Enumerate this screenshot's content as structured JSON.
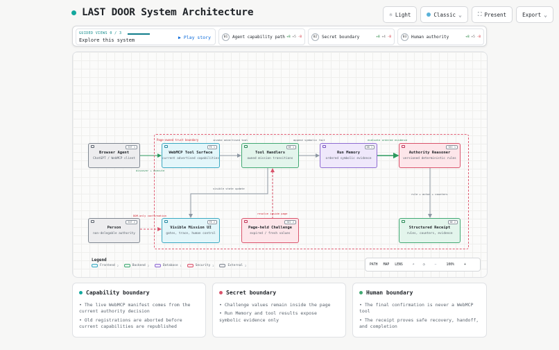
{
  "header": {
    "title": "LAST DOOR System Architecture",
    "buttons": {
      "theme": "Light",
      "style": "Classic",
      "present": "Present",
      "export": "Export"
    }
  },
  "guided": {
    "kicker": "GUIDED VIEWS 0 / 3",
    "subtitle": "Explore this system",
    "play": "▶ Play story",
    "views": [
      {
        "num": "01",
        "label": "Agent capability path",
        "plus": "+8",
        "neutral": "+5",
        "minus": "-8"
      },
      {
        "num": "02",
        "label": "Secret boundary",
        "plus": "+8",
        "neutral": "+4",
        "minus": "-8"
      },
      {
        "num": "03",
        "label": "Human authority",
        "plus": "+8",
        "neutral": "+5",
        "minus": "-8"
      }
    ]
  },
  "diagram": {
    "trust_label": "Page-owned trust boundary",
    "nodes": {
      "browser_agent": {
        "title": "Browser Agent",
        "sub": "ChatGPT / WebMCP client",
        "badge": "EXT 1"
      },
      "webmcp_tool": {
        "title": "WebMCP Tool Surface",
        "sub": "current advertised capabilities",
        "badge": "FE 1"
      },
      "tool_handlers": {
        "title": "Tool Handlers",
        "sub": "owned mission transitions",
        "badge": "BE 1"
      },
      "run_memory": {
        "title": "Run Memory",
        "sub": "ordered symbolic evidence",
        "badge": "DB 1"
      },
      "authority": {
        "title": "Authority Reasoner",
        "sub": "versioned deterministic rules",
        "badge": "SEC 1"
      },
      "person": {
        "title": "Person",
        "sub": "non-delegable authority",
        "badge": "EXT 2"
      },
      "mission_ui": {
        "title": "Visible Mission UI",
        "sub": "gates, trace, human control",
        "badge": "FE 2"
      },
      "challenge": {
        "title": "Page-held Challenge",
        "sub": "expired / fresh values",
        "badge": "SEC 2"
      },
      "receipt": {
        "title": "Structured Receipt",
        "sub": "rules, counters, evidence",
        "badge": "BE 2"
      }
    },
    "edges": {
      "discover": "discover + execute",
      "invoke": "invoke advertised tool",
      "append": "append symbolic fact",
      "evaluate": "evaluate ordered evidence",
      "visible_state": "visible state update",
      "resolve": "resolve inside page",
      "confirm": "DOM-only confirmation",
      "rule": "rule + actor + counters"
    },
    "legend": {
      "title": "Legend",
      "items": [
        {
          "label": "Frontend",
          "count": "2"
        },
        {
          "label": "Backend",
          "count": "2"
        },
        {
          "label": "Database",
          "count": "1"
        },
        {
          "label": "Security",
          "count": "2"
        },
        {
          "label": "External",
          "count": "2"
        }
      ]
    },
    "controls": {
      "path": "PATH",
      "map": "MAP",
      "lens": "LENS",
      "zoom": "100%",
      "minus": "−",
      "plus": "+"
    }
  },
  "colors": {
    "accent_teal": "#13a89e",
    "frontend": "#3aa8c1",
    "backend": "#41a872",
    "database": "#8e6bd1",
    "security": "#d9536b",
    "external": "#7f8791"
  },
  "cards": [
    {
      "title": "Capability boundary",
      "dot": "#13a89e",
      "bullets": [
        "• The live WebMCP manifest comes from the current authority decision",
        "• Old registrations are aborted before current capabilities are republished"
      ]
    },
    {
      "title": "Secret boundary",
      "dot": "#d9536b",
      "bullets": [
        "• Challenge values remain inside the page",
        "• Run Memory and tool results expose symbolic evidence only"
      ]
    },
    {
      "title": "Human boundary",
      "dot": "#41a872",
      "bullets": [
        "• The final confirmation is never a WebMCP tool",
        "• The receipt proves safe recovery, handoff, and completion"
      ]
    }
  ]
}
